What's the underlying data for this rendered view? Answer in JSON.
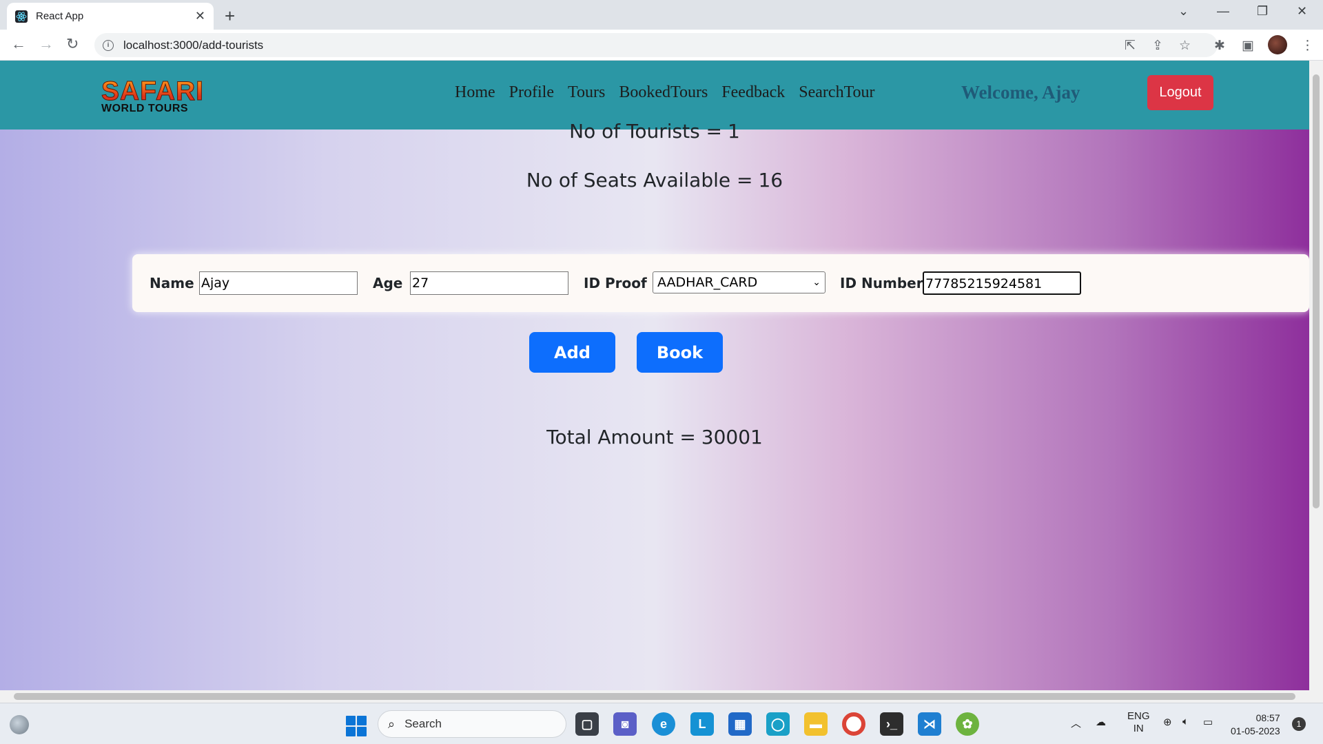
{
  "browser": {
    "tab_title": "React App",
    "url": "localhost:3000/add-tourists"
  },
  "navbar": {
    "logo_line1": "SAFARI",
    "logo_line2": "WORLD TOURS",
    "links": [
      "Home",
      "Profile",
      "Tours",
      "BookedTours",
      "Feedback",
      "SearchTour"
    ],
    "welcome": "Welcome, Ajay",
    "logout_label": "Logout"
  },
  "stats": {
    "tourists_label": "No of Tourists =",
    "tourists_value": "1",
    "seats_label": "No of Seats Available =",
    "seats_value": "16",
    "total_label": "Total Amount =",
    "total_value": "30001"
  },
  "form": {
    "name_label": "Name",
    "name_value": "Ajay",
    "age_label": "Age",
    "age_value": "27",
    "idproof_label": "ID Proof",
    "idproof_value": "AADHAR_CARD",
    "idnumber_label": "ID Number",
    "idnumber_value": "77785215924581",
    "add_label": "Add",
    "book_label": "Book"
  },
  "taskbar": {
    "search_placeholder": "Search",
    "lang_line1": "ENG",
    "lang_line2": "IN",
    "time": "08:57",
    "date": "01-05-2023",
    "notification_count": "1"
  },
  "colors": {
    "navbar": "#2b97a5",
    "logout": "#dc3545",
    "primary_button": "#0d6efd",
    "welcome_text": "#1f5b78"
  }
}
